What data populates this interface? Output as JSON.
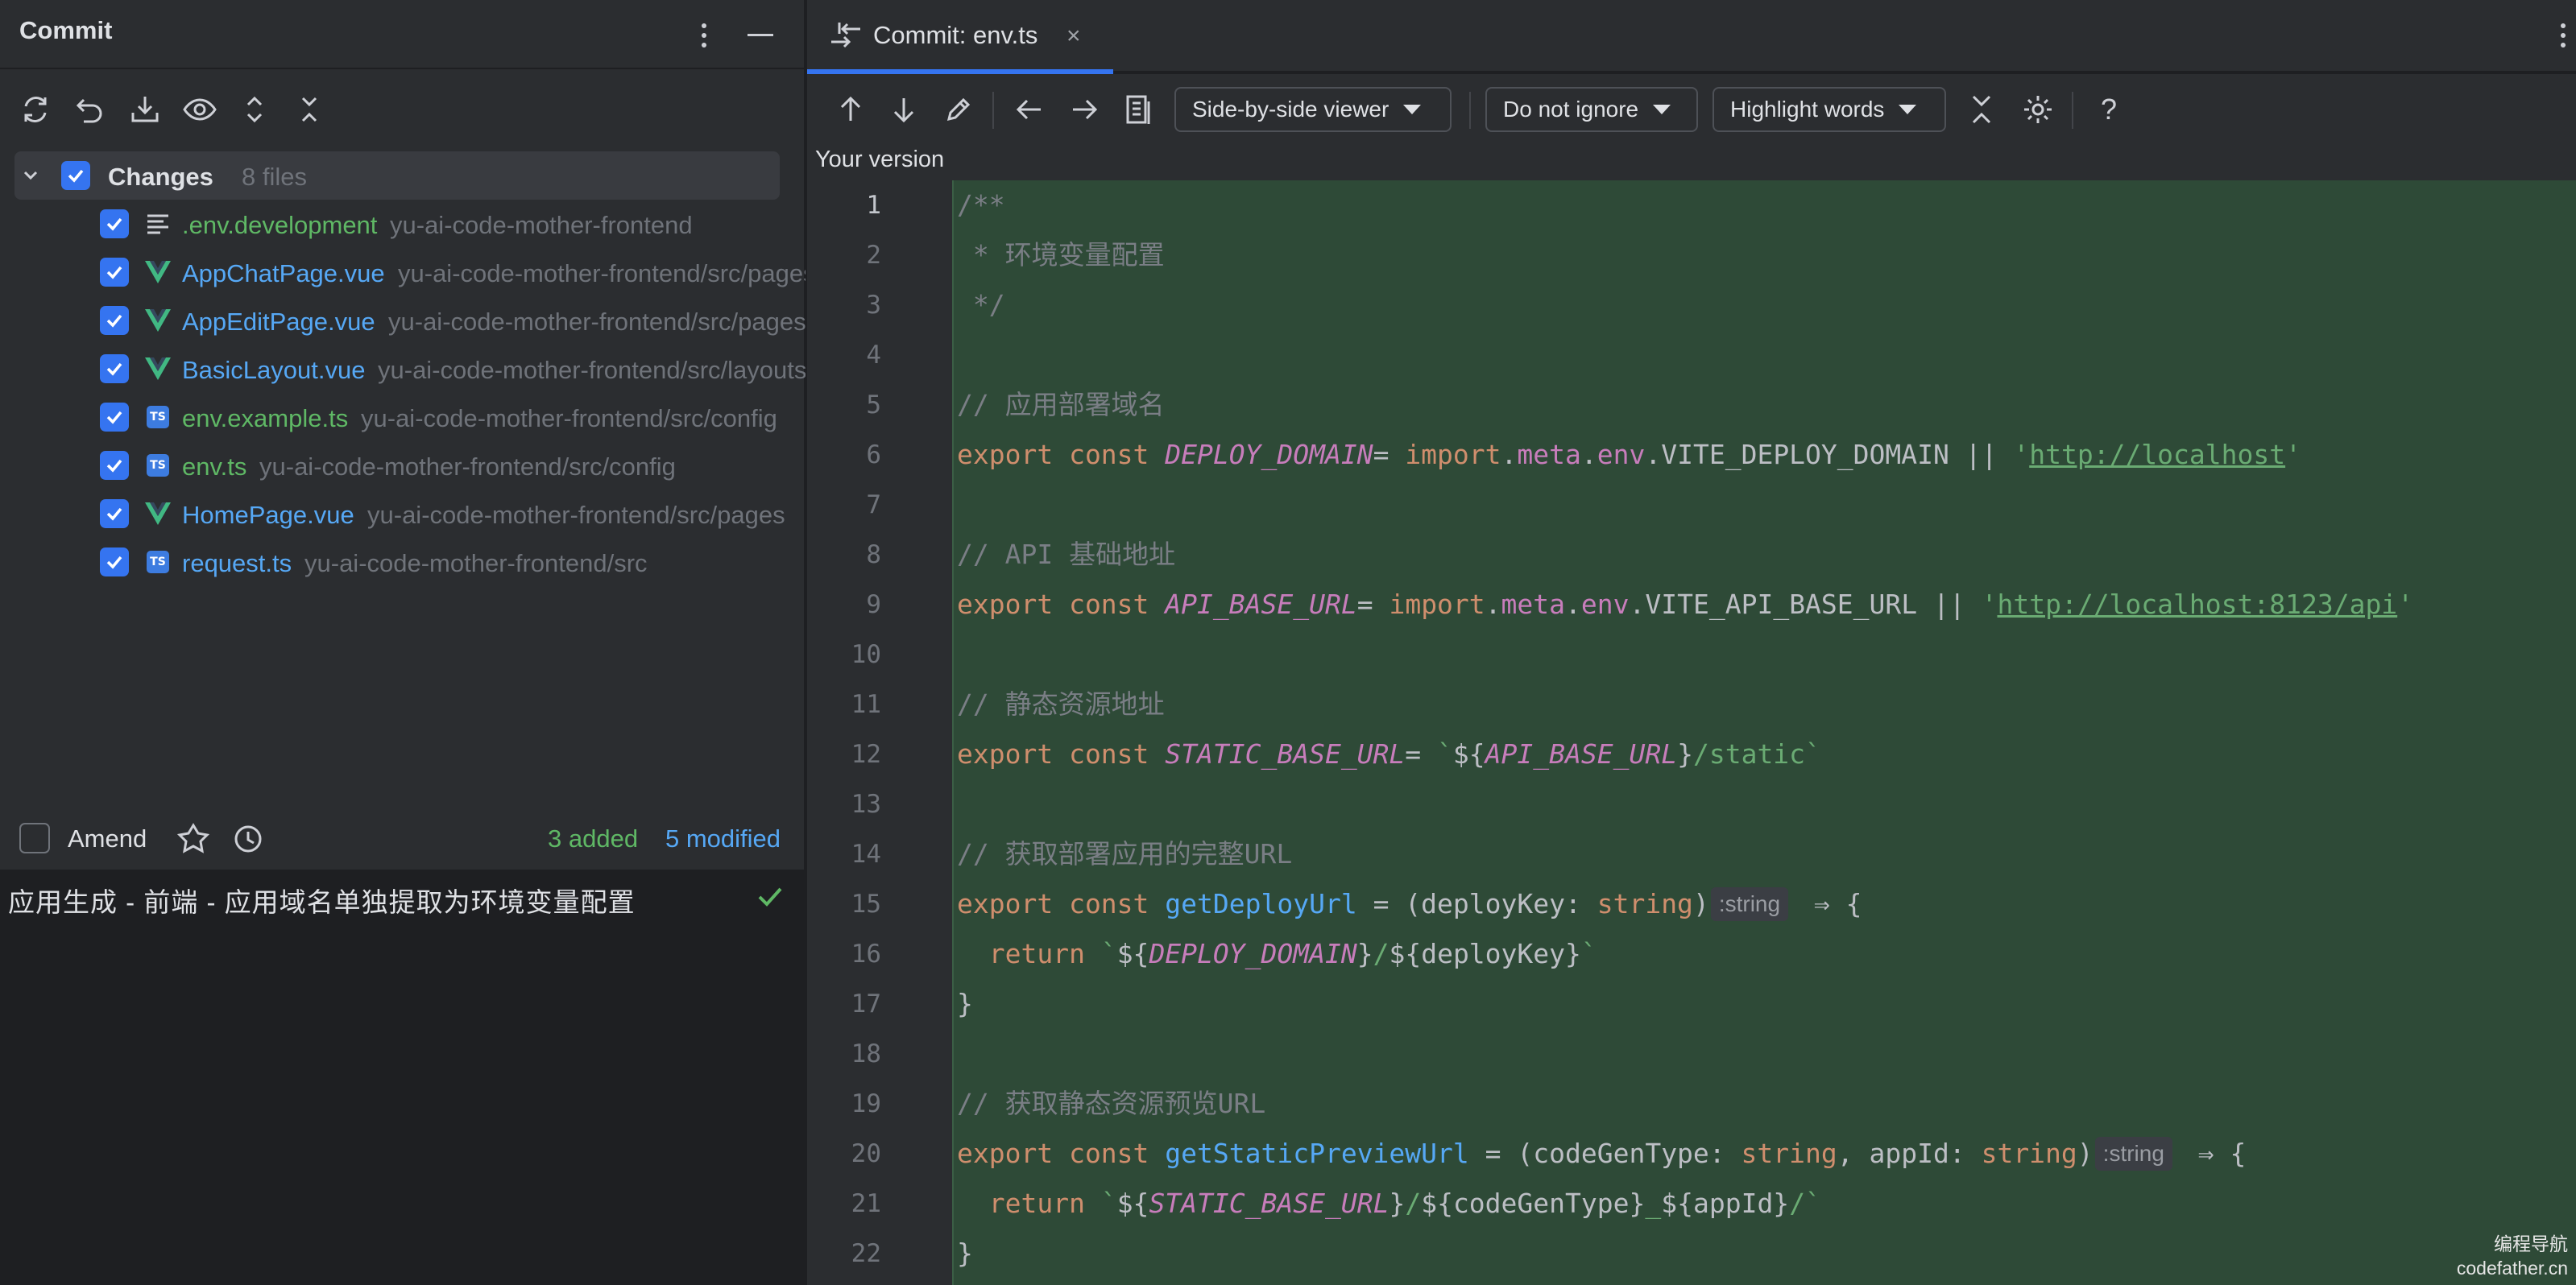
{
  "left": {
    "title": "Commit",
    "changes": {
      "label": "Changes",
      "count": "8 files"
    },
    "files": [
      {
        "name": ".env.development",
        "path": "yu-ai-code-mother-frontend",
        "icon": "text-file-icon",
        "color": "green"
      },
      {
        "name": "AppChatPage.vue",
        "path": "yu-ai-code-mother-frontend/src/pages/app",
        "icon": "vue-file-icon",
        "color": "blue"
      },
      {
        "name": "AppEditPage.vue",
        "path": "yu-ai-code-mother-frontend/src/pages/app",
        "icon": "vue-file-icon",
        "color": "blue"
      },
      {
        "name": "BasicLayout.vue",
        "path": "yu-ai-code-mother-frontend/src/layouts",
        "icon": "vue-file-icon",
        "color": "blue"
      },
      {
        "name": "env.example.ts",
        "path": "yu-ai-code-mother-frontend/src/config",
        "icon": "ts-file-icon",
        "color": "green"
      },
      {
        "name": "env.ts",
        "path": "yu-ai-code-mother-frontend/src/config",
        "icon": "ts-file-icon",
        "color": "green"
      },
      {
        "name": "HomePage.vue",
        "path": "yu-ai-code-mother-frontend/src/pages",
        "icon": "vue-file-icon",
        "color": "blue"
      },
      {
        "name": "request.ts",
        "path": "yu-ai-code-mother-frontend/src",
        "icon": "ts-file-icon",
        "color": "blue"
      }
    ],
    "amend_label": "Amend",
    "added": "3 added",
    "modified": "5 modified",
    "commit_message": "应用生成 - 前端 - 应用域名单独提取为环境变量配置"
  },
  "right": {
    "tab_label": "Commit: env.ts",
    "tab_close": "×",
    "viewer_select": "Side-by-side viewer",
    "ignore_select": "Do not ignore",
    "highlight_select": "Highlight words",
    "help": "?",
    "your_version": "Your version",
    "lines": [
      [
        [
          "c-comment",
          "/**"
        ]
      ],
      [
        [
          "c-comment",
          " * 环境变量配置"
        ]
      ],
      [
        [
          "c-comment",
          " */"
        ]
      ],
      [],
      [
        [
          "c-comment",
          "// 应用部署域名"
        ]
      ],
      [
        [
          "c-kw",
          "export const "
        ],
        [
          "c-const",
          "DEPLOY_DOMAIN"
        ],
        [
          "",
          "= "
        ],
        [
          "c-kw",
          "import"
        ],
        [
          "",
          "."
        ],
        [
          "c-prop",
          "meta"
        ],
        [
          "",
          "."
        ],
        [
          "c-prop",
          "env"
        ],
        [
          "",
          ".VITE_DEPLOY_DOMAIN || "
        ],
        [
          "c-str",
          "'"
        ],
        [
          "c-link",
          "http://localhost"
        ],
        [
          "c-str",
          "'"
        ]
      ],
      [],
      [
        [
          "c-comment",
          "// API 基础地址"
        ]
      ],
      [
        [
          "c-kw",
          "export const "
        ],
        [
          "c-const",
          "API_BASE_URL"
        ],
        [
          "",
          "= "
        ],
        [
          "c-kw",
          "import"
        ],
        [
          "",
          "."
        ],
        [
          "c-prop",
          "meta"
        ],
        [
          "",
          "."
        ],
        [
          "c-prop",
          "env"
        ],
        [
          "",
          ".VITE_API_BASE_URL || "
        ],
        [
          "c-str",
          "'"
        ],
        [
          "c-link",
          "http://localhost:8123/api"
        ],
        [
          "c-str",
          "'"
        ]
      ],
      [],
      [
        [
          "c-comment",
          "// 静态资源地址"
        ]
      ],
      [
        [
          "c-kw",
          "export const "
        ],
        [
          "c-const",
          "STATIC_BASE_URL"
        ],
        [
          "",
          "= "
        ],
        [
          "c-str",
          "`"
        ],
        [
          "",
          "${"
        ],
        [
          "c-const",
          "API_BASE_URL"
        ],
        [
          "",
          "}"
        ],
        [
          "c-str",
          "/static`"
        ]
      ],
      [],
      [
        [
          "c-comment",
          "// 获取部署应用的完整URL"
        ]
      ],
      [
        [
          "c-kw",
          "export const "
        ],
        [
          "c-fn",
          "getDeployUrl"
        ],
        [
          "",
          " = (deployKey: "
        ],
        [
          "c-type",
          "string"
        ],
        [
          "",
          ")"
        ],
        [
          "hint",
          ":string"
        ],
        [
          "",
          " ⇒ {"
        ]
      ],
      [
        [
          "c-kw",
          "  return "
        ],
        [
          "c-str",
          "`"
        ],
        [
          "",
          "${"
        ],
        [
          "c-const",
          "DEPLOY_DOMAIN"
        ],
        [
          "",
          "}"
        ],
        [
          "c-str",
          "/"
        ],
        [
          "",
          "${deployKey}"
        ],
        [
          "c-str",
          "`"
        ]
      ],
      [
        [
          "",
          "}"
        ]
      ],
      [],
      [
        [
          "c-comment",
          "// 获取静态资源预览URL"
        ]
      ],
      [
        [
          "c-kw",
          "export const "
        ],
        [
          "c-fn",
          "getStaticPreviewUrl"
        ],
        [
          "",
          " = (codeGenType: "
        ],
        [
          "c-type",
          "string"
        ],
        [
          "",
          ", appId: "
        ],
        [
          "c-type",
          "string"
        ],
        [
          "",
          ")"
        ],
        [
          "hint",
          ":string"
        ],
        [
          "",
          " ⇒ {"
        ]
      ],
      [
        [
          "c-kw",
          "  return "
        ],
        [
          "c-str",
          "`"
        ],
        [
          "",
          "${"
        ],
        [
          "c-const",
          "STATIC_BASE_URL"
        ],
        [
          "",
          "}"
        ],
        [
          "c-str",
          "/"
        ],
        [
          "",
          "${codeGenType}"
        ],
        [
          "c-str",
          "_"
        ],
        [
          "",
          "${appId}"
        ],
        [
          "c-str",
          "/`"
        ]
      ],
      [
        [
          "",
          "}"
        ]
      ]
    ]
  },
  "watermark": {
    "line1": "编程导航",
    "line2": "codefather.cn"
  },
  "colors": {
    "accent": "#3574f0",
    "added": "#5fb865",
    "modified": "#56a8f5",
    "diff_bg": "#2e4a37"
  }
}
